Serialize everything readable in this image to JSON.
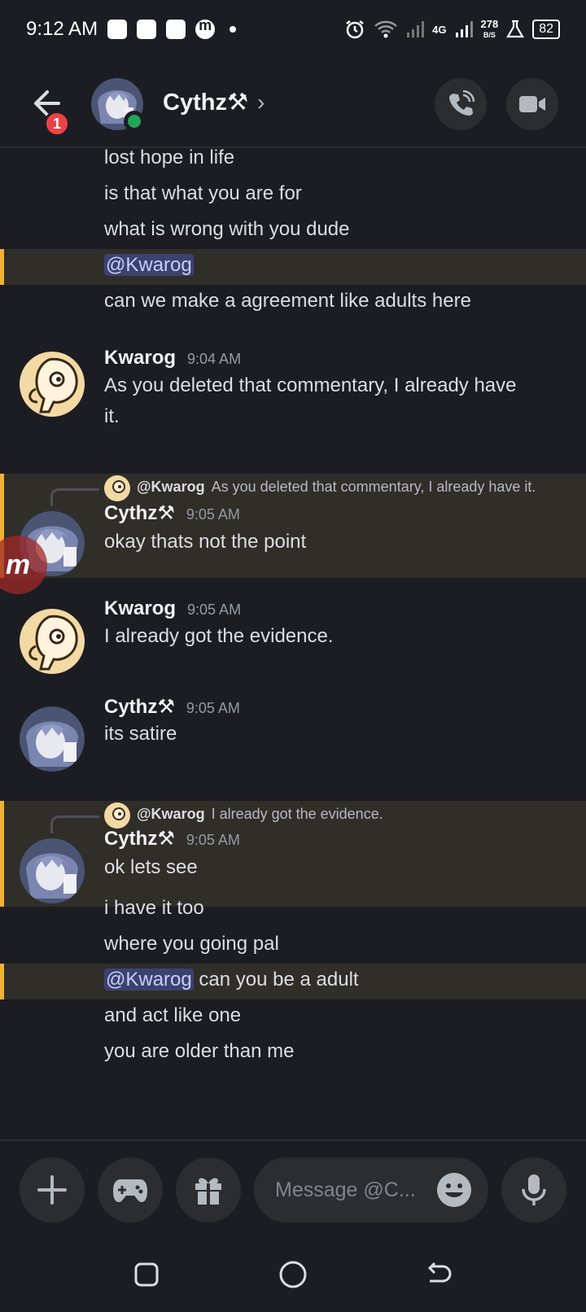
{
  "status": {
    "time": "9:12 AM",
    "net_type": "4G",
    "speed_value": "278",
    "speed_unit": "B/S",
    "battery": "82"
  },
  "header": {
    "unread_count": "1",
    "name": "Cythz⚒",
    "chevron": "›",
    "icons": [
      "back-arrow-icon",
      "phone-call-icon",
      "video-camera-icon"
    ]
  },
  "messages": {
    "top_lines": [
      "lost hope in life",
      "is that what you are for",
      "what is wrong with you dude"
    ],
    "mention1": "@Kwarog",
    "line_agreement": "can we make  a agreement like adults here",
    "m1": {
      "author": "Kwarog",
      "time": "9:04 AM",
      "text1": "As you deleted that commentary, I already have",
      "text2": "it."
    },
    "m2": {
      "reply_author": "@Kwarog",
      "reply_text": "As you deleted that commentary, I already have it.",
      "author": "Cythz⚒",
      "time": "9:05 AM",
      "text": "okay thats not the point"
    },
    "m3": {
      "author": "Kwarog",
      "time": "9:05 AM",
      "text": "I already got the evidence."
    },
    "m4": {
      "author": "Cythz⚒",
      "time": "9:05 AM",
      "text": "its satire"
    },
    "m5": {
      "reply_author": "@Kwarog",
      "reply_text": "I already got the evidence.",
      "author": "Cythz⚒",
      "time": "9:05 AM",
      "text": "ok lets see"
    },
    "tail1": "i have it too",
    "tail2": "where you going pal",
    "mention2": "@Kwarog",
    "tail3": " can you be a adult",
    "tail4": "and act like one",
    "tail5": "you are older than me",
    "floating_bubble": "m"
  },
  "composer": {
    "placeholder": "Message @C...",
    "icons": [
      "plus-icon",
      "gamepad-icon",
      "gift-icon",
      "emoji-icon",
      "microphone-icon"
    ]
  },
  "navbar": {
    "icons": [
      "recents-icon",
      "home-icon",
      "back-icon"
    ]
  },
  "colors": {
    "background": "#1c1d22",
    "highlight": "#302e29",
    "accent": "#f0b232",
    "mention": "#3c4270",
    "online": "#23a55a",
    "badge": "#ed4245"
  }
}
